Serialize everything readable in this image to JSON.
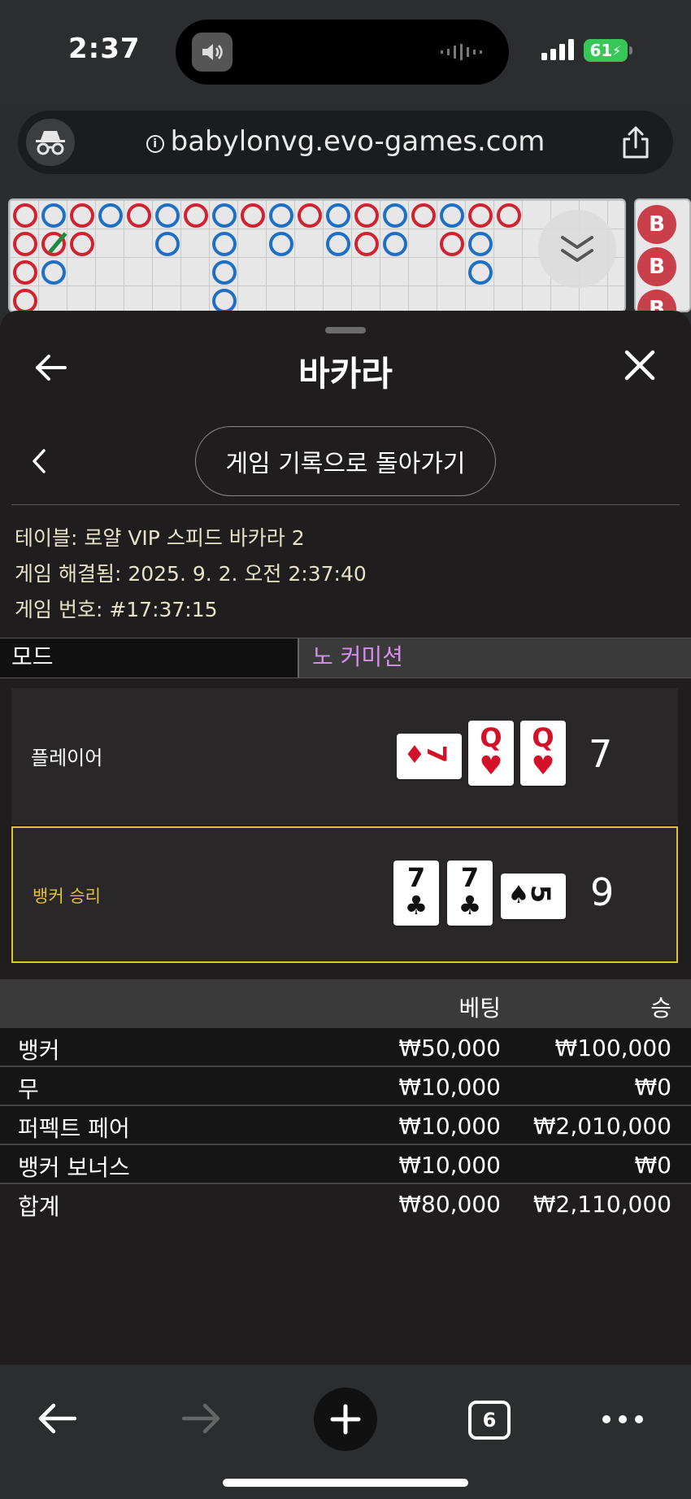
{
  "status_bar": {
    "time": "2:37",
    "battery": "61"
  },
  "browser": {
    "url": "babylonvg.evo-games.com",
    "open_tabs": "6"
  },
  "road_side_label": "B",
  "sheet": {
    "title": "바카라",
    "back_history_label": "게임 기록으로 돌아가기",
    "table_info": "테이블: 로얄 VIP 스피드 바카라 2",
    "resolved_info": "게임 해결됨: 2025. 9. 2. 오전 2:37:40",
    "game_number_info": "게임 번호: #17:37:15",
    "mode_label": "모드",
    "mode_value": "노 커미션"
  },
  "hands": {
    "player": {
      "label": "플레이어",
      "score": "7",
      "cards": [
        {
          "rank": "7",
          "suit": "♦",
          "color": "red"
        },
        {
          "rank": "Q",
          "suit": "♥",
          "color": "red"
        },
        {
          "rank": "Q",
          "suit": "♥",
          "color": "red"
        }
      ]
    },
    "banker": {
      "label": "뱅커 승리",
      "score": "9",
      "cards": [
        {
          "rank": "7",
          "suit": "♣",
          "color": "black"
        },
        {
          "rank": "7",
          "suit": "♣",
          "color": "black"
        },
        {
          "rank": "5",
          "suit": "♠",
          "color": "black"
        }
      ]
    }
  },
  "bets": {
    "header": {
      "bet": "베팅",
      "win": "승"
    },
    "rows": [
      {
        "name": "뱅커",
        "bet": "₩50,000",
        "win": "₩100,000"
      },
      {
        "name": "무",
        "bet": "₩10,000",
        "win": "₩0"
      },
      {
        "name": "퍼펙트 페어",
        "bet": "₩10,000",
        "win": "₩2,010,000"
      },
      {
        "name": "뱅커 보너스",
        "bet": "₩10,000",
        "win": "₩0"
      }
    ],
    "total": {
      "name": "합계",
      "bet": "₩80,000",
      "win": "₩2,110,000"
    }
  },
  "colors": {
    "banker_win_label": "#e0c13a",
    "mode_value": "#d88ef0",
    "battery": "#37c758"
  }
}
